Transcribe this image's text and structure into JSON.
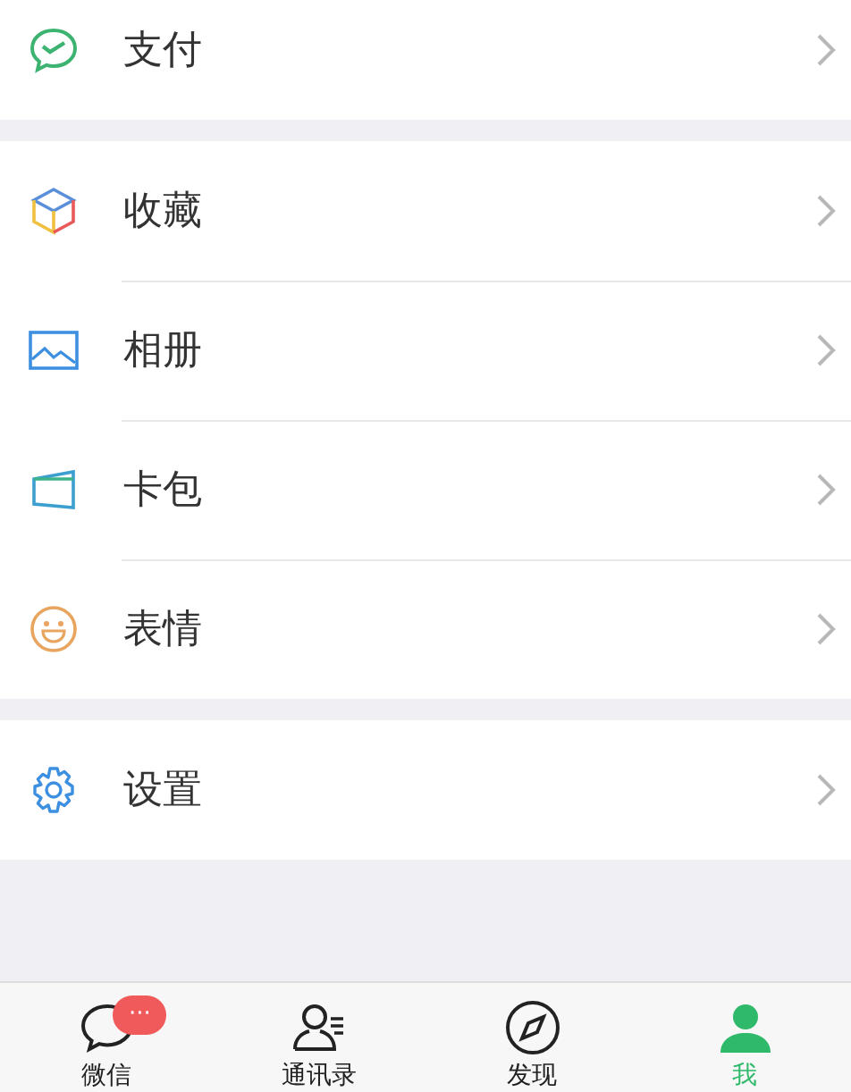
{
  "sections": [
    {
      "items": [
        {
          "kind": "pay",
          "label": "支付"
        }
      ]
    },
    {
      "items": [
        {
          "kind": "favorites",
          "label": "收藏"
        },
        {
          "kind": "album",
          "label": "相册"
        },
        {
          "kind": "cards",
          "label": "卡包"
        },
        {
          "kind": "sticker",
          "label": "表情"
        }
      ]
    },
    {
      "items": [
        {
          "kind": "settings",
          "label": "设置"
        }
      ]
    }
  ],
  "tabs": [
    {
      "kind": "chats",
      "label": "微信",
      "selected": false,
      "badge": "···"
    },
    {
      "kind": "contacts",
      "label": "通讯录",
      "selected": false
    },
    {
      "kind": "discover",
      "label": "发现",
      "selected": false
    },
    {
      "kind": "me",
      "label": "我",
      "selected": true
    }
  ]
}
